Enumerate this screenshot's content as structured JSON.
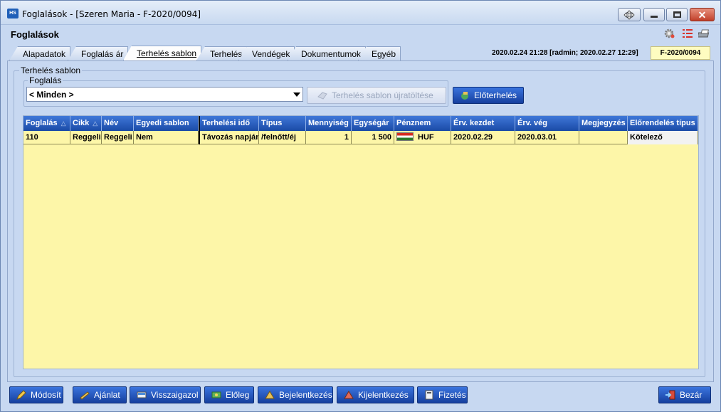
{
  "window": {
    "app_icon": "HS",
    "title": "Foglalások - [Szeren Maria - F-2020/0094]"
  },
  "header": {
    "title": "Foglalások",
    "icons": [
      "gear-icon",
      "list-icon",
      "printer-icon"
    ]
  },
  "tabs": [
    {
      "label": "Alapadatok",
      "active": false
    },
    {
      "label": "Foglalás ár",
      "active": false
    },
    {
      "label": "Terhelés sablon",
      "active": true
    },
    {
      "label": "Terhelés",
      "active": false
    },
    {
      "label": "Vendégek",
      "active": false
    },
    {
      "label": "Dokumentumok",
      "active": false
    },
    {
      "label": "Egyéb",
      "active": false
    }
  ],
  "stamp": "2020.02.24 21:28 [radmin; 2020.02.27 12:29]",
  "doc_number": "F-2020/0094",
  "template": {
    "group_label": "Terhelés sablon",
    "booking_label": "Foglalás",
    "booking_value": "< Minden >",
    "reload_button": "Terhelés sablon újratöltése",
    "precharge_button": "Előterhelés"
  },
  "grid": {
    "columns": [
      "Foglalás",
      "Cikk",
      "Név",
      "Egyedi sablon",
      "Terhelési idő",
      "Típus",
      "Mennyiség",
      "Egységár",
      "Pénznem",
      "Érv. kezdet",
      "Érv. vég",
      "Megjegyzés",
      "Előrendelés típus"
    ],
    "sort_marker": "△",
    "rows": [
      {
        "foglalas": "110",
        "cikk": "Reggeli",
        "nev": "Reggeli",
        "egyedi": "Nem",
        "terhelesi_ido": "Távozás napján",
        "tipus": "/felnőtt/éj",
        "mennyiseg": "1",
        "egysegar": "1 500",
        "penznem": "HUF",
        "erv_kezdet": "2020.02.29",
        "erv_veg": "2020.03.01",
        "megjegyzes": "",
        "elorendeles": "Kötelező"
      }
    ]
  },
  "bottom_buttons": {
    "modosit": "Módosít",
    "ajanlat": "Ajánlat",
    "visszaigazol": "Visszaigazol",
    "eloleg": "Előleg",
    "bejelentkezes": "Bejelentkezés",
    "kijelentkezes": "Kijelentkezés",
    "fizetes": "Fizetés",
    "bezar": "Bezár"
  },
  "colors": {
    "grid_header": "#1a4aa6",
    "grid_body": "#fdf6a8",
    "button_blue": "#163f9e",
    "window_bg": "#c7d8f1"
  }
}
